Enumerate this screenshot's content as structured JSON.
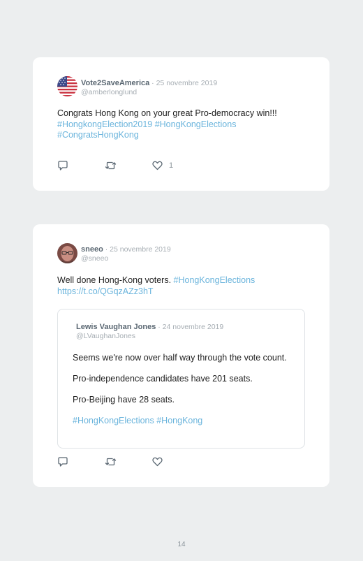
{
  "tweets": [
    {
      "name": "Vote2SaveAmerica",
      "separator": " · ",
      "date": "25 novembre 2019",
      "handle": "@amberlonglund",
      "text": "Congrats Hong Kong on your great Pro-democracy win!!!",
      "hashtags": [
        "#HongkongElection2019",
        "#HongKongElections",
        "#CongratsHongKong"
      ],
      "like_count": "1",
      "avatar_icon": "us-flag-icon"
    },
    {
      "name": "sneeo",
      "separator": " · ",
      "date": "25 novembre 2019",
      "handle": "@sneeo",
      "text": "Well done Hong-Kong voters.",
      "hashtag": "#HongKongElections",
      "link": "https://t.co/QGqzAZz3hT",
      "like_count": "",
      "avatar_icon": "person-avatar-icon",
      "quote": {
        "name": "Lewis Vaughan Jones",
        "separator": " · ",
        "date": "24 novembre 2019",
        "handle": "@LVaughanJones",
        "paragraphs": [
          "Seems we're now over half way through the vote count.",
          "Pro-independence candidates have 201 seats.",
          "Pro-Beijing have 28 seats."
        ],
        "hashtags": [
          "#HongKongElections",
          "#HongKong"
        ]
      }
    }
  ],
  "page_number": "14",
  "colors": {
    "background": "#eceeef",
    "card": "#ffffff",
    "link": "#6ab4dc",
    "name": "#5a6772",
    "muted": "#a6adb3",
    "icon": "#5a6772"
  }
}
